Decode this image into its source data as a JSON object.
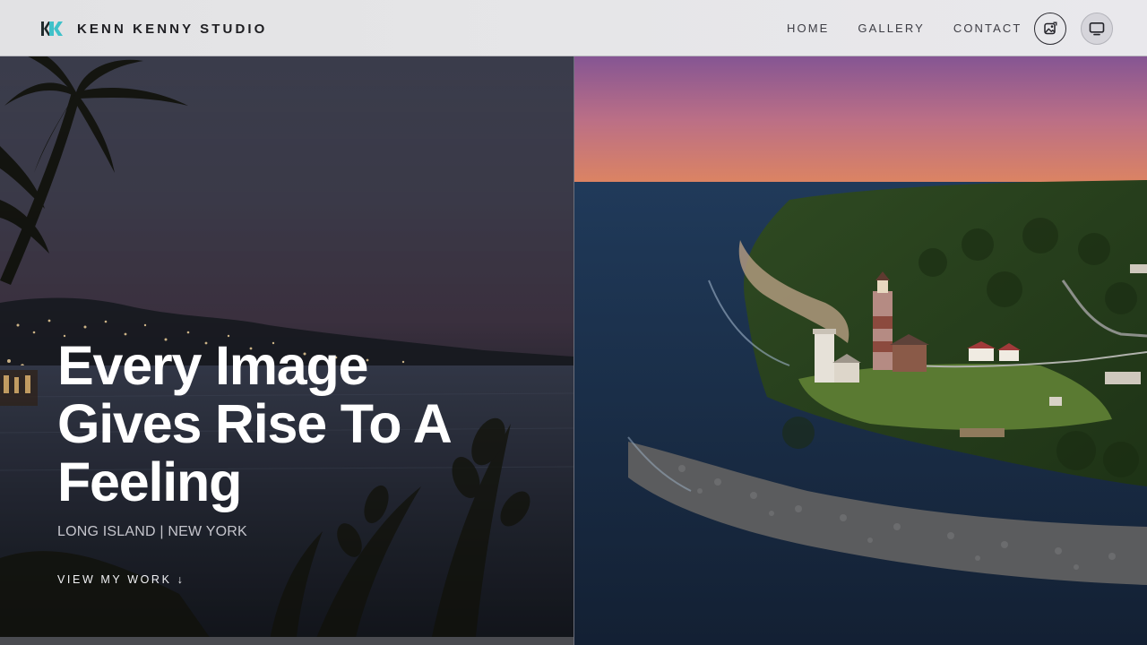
{
  "brand": {
    "name": "KENN KENNY STUDIO",
    "logo_icon": "kk-logo-icon",
    "accent_color": "#3fc1c9"
  },
  "nav": {
    "items": [
      {
        "label": "HOME"
      },
      {
        "label": "GALLERY"
      },
      {
        "label": "CONTACT"
      }
    ],
    "photo_button_icon": "photo-icon",
    "display_button_icon": "monitor-icon"
  },
  "hero": {
    "title": "Every Image Gives Rise To A Feeling",
    "subtitle": "LONG ISLAND | NEW YORK",
    "cta_label": "VIEW MY WORK ↓"
  }
}
